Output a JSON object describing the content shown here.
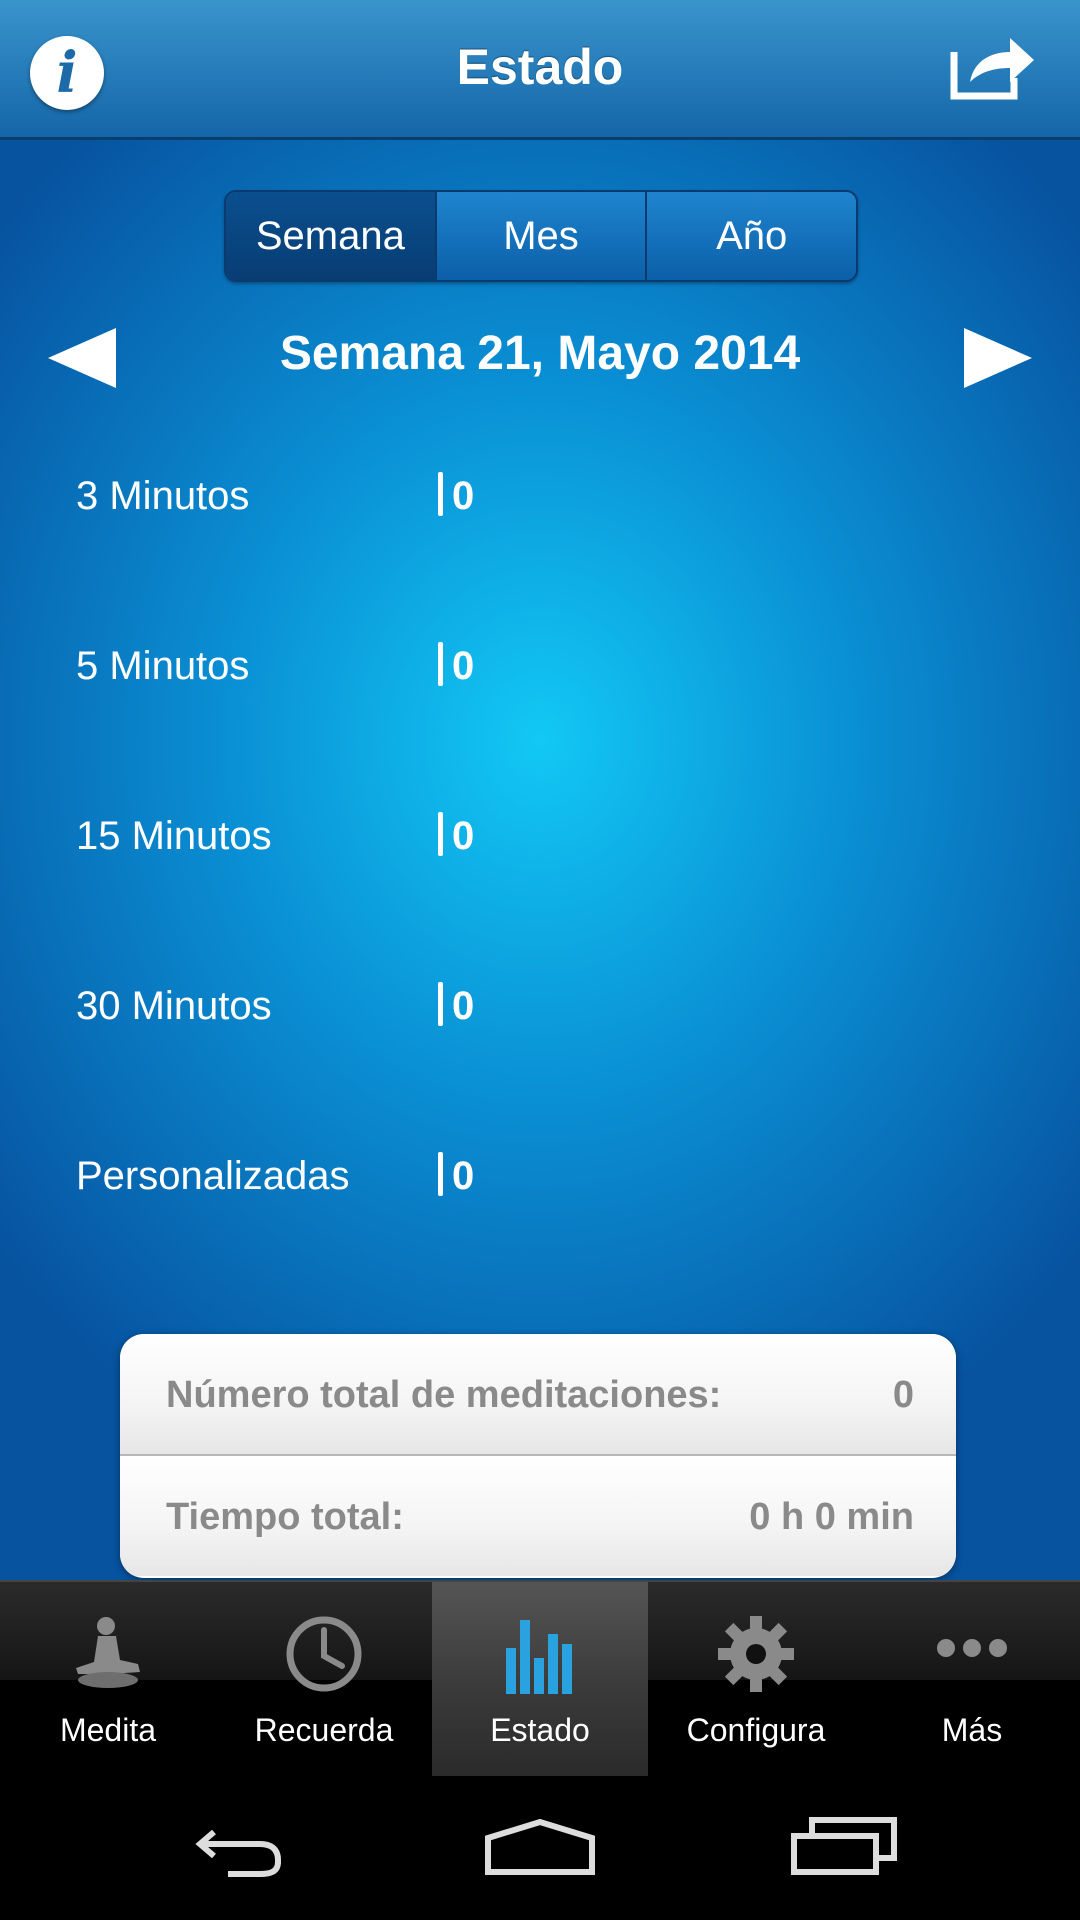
{
  "header": {
    "title": "Estado",
    "info_icon": "info-icon",
    "share_icon": "share-icon"
  },
  "segments": [
    {
      "label": "Semana",
      "active": true
    },
    {
      "label": "Mes",
      "active": false
    },
    {
      "label": "Año",
      "active": false
    }
  ],
  "period": {
    "label": "Semana 21, Mayo 2014",
    "prev_icon": "chevron-left-icon",
    "next_icon": "chevron-right-icon"
  },
  "stats": [
    {
      "label": "3 Minutos",
      "value": "0"
    },
    {
      "label": "5 Minutos",
      "value": "0"
    },
    {
      "label": "15 Minutos",
      "value": "0"
    },
    {
      "label": "30 Minutos",
      "value": "0"
    },
    {
      "label": "Personalizadas",
      "value": "0"
    }
  ],
  "totals": {
    "meditations_label": "Número total de meditaciones:",
    "meditations_value": "0",
    "time_label": "Tiempo total:",
    "time_value": "0 h  0 min"
  },
  "tabs": [
    {
      "label": "Medita",
      "icon": "meditation-icon",
      "active": false
    },
    {
      "label": "Recuerda",
      "icon": "clock-icon",
      "active": false
    },
    {
      "label": "Estado",
      "icon": "bar-chart-icon",
      "active": true
    },
    {
      "label": "Configura",
      "icon": "gear-icon",
      "active": false
    },
    {
      "label": "Más",
      "icon": "more-icon",
      "active": false
    }
  ],
  "system_nav": {
    "back_icon": "back-icon",
    "home_icon": "home-icon",
    "recents_icon": "recents-icon"
  }
}
